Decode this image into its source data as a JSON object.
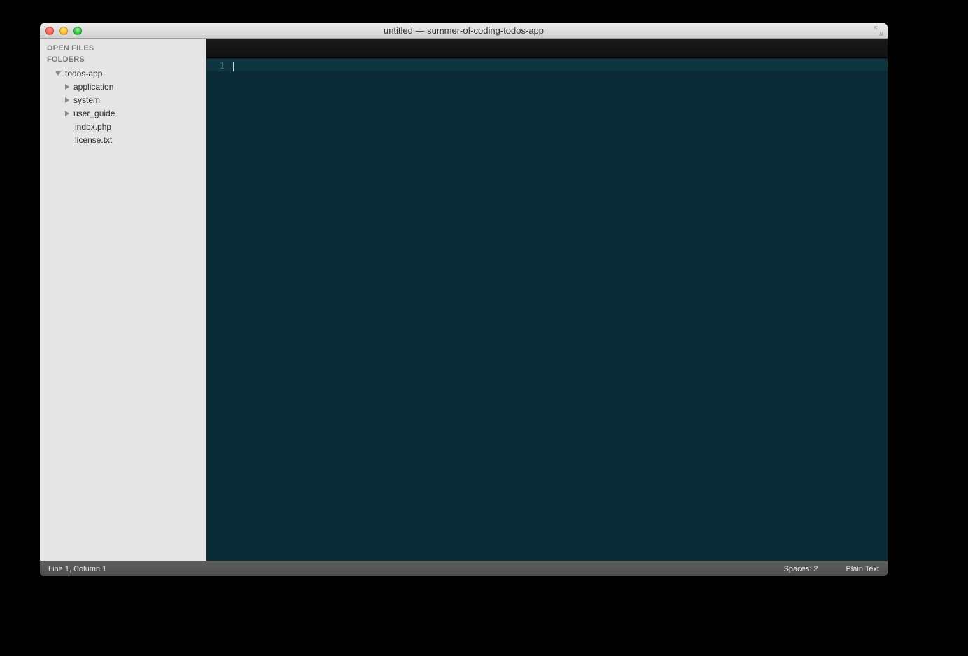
{
  "window": {
    "title": "untitled — summer-of-coding-todos-app"
  },
  "sidebar": {
    "open_files_label": "OPEN FILES",
    "folders_label": "FOLDERS",
    "tree": {
      "root": {
        "name": "todos-app"
      },
      "children": [
        {
          "name": "application",
          "type": "folder"
        },
        {
          "name": "system",
          "type": "folder"
        },
        {
          "name": "user_guide",
          "type": "folder"
        },
        {
          "name": "index.php",
          "type": "file"
        },
        {
          "name": "license.txt",
          "type": "file"
        }
      ]
    }
  },
  "editor": {
    "line_number": "1"
  },
  "statusbar": {
    "position": "Line 1, Column 1",
    "indent": "Spaces: 2",
    "syntax": "Plain Text"
  }
}
